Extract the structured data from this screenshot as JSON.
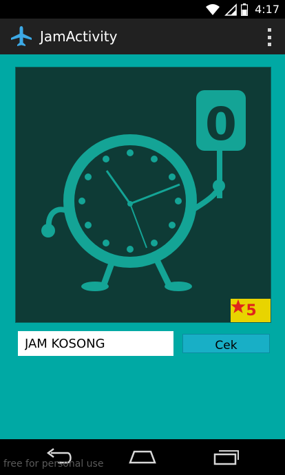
{
  "status_bar": {
    "time": "4:17"
  },
  "action_bar": {
    "title": "JamActivity"
  },
  "puzzle": {
    "number_on_sign": "0"
  },
  "coins": {
    "count": "5"
  },
  "answer": {
    "value": "JAM KOSONG"
  },
  "check_button": {
    "label": "Cek"
  },
  "watermark": "free for personal use",
  "colors": {
    "background": "#00a9a4",
    "picture_bg": "#0e3b36",
    "clock_teal": "#14a496",
    "badge_yellow": "#e8d400",
    "badge_red": "#e0241b",
    "button": "#18afc6"
  },
  "icons": [
    "wifi-icon",
    "signal-icon",
    "battery-icon",
    "airplane-icon",
    "overflow-menu-icon",
    "star-icon",
    "back-icon",
    "home-icon",
    "recents-icon"
  ]
}
